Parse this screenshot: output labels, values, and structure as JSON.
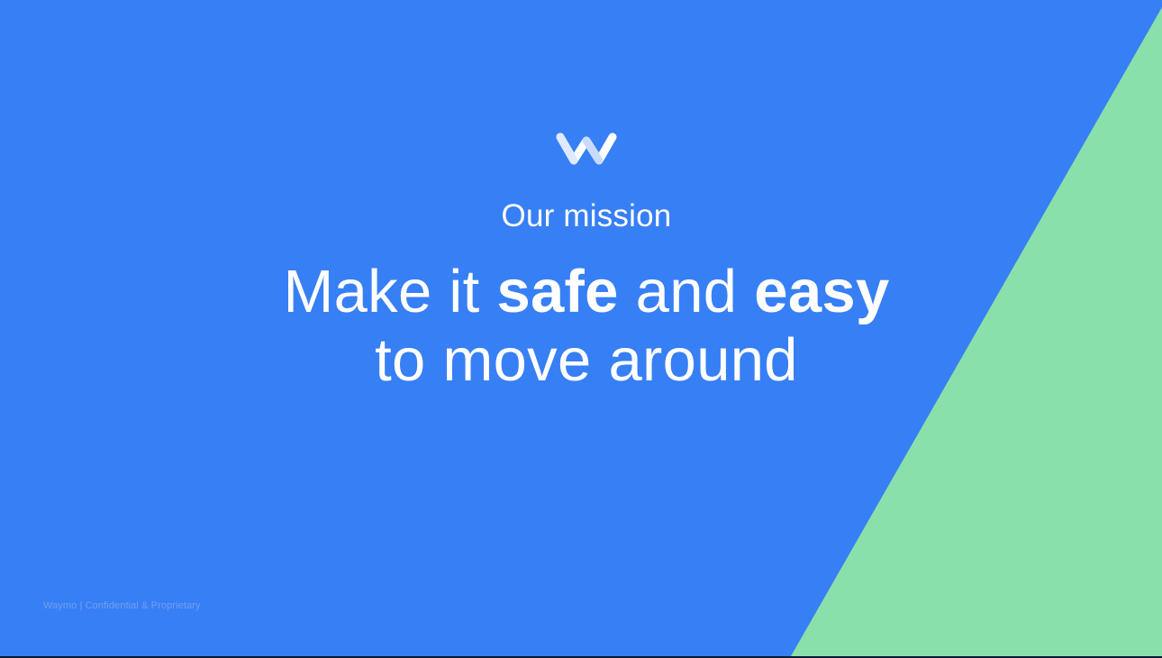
{
  "slide": {
    "kicker": "Our mission",
    "headline": {
      "line1_part1": "Make it ",
      "line1_bold1": "safe",
      "line1_part2": " and ",
      "line1_bold2": "easy",
      "line2": "to move around"
    },
    "footer": "Waymo | Confidential & Proprietary"
  },
  "logo": {
    "icon": "waymo-w-logo-icon"
  },
  "colors": {
    "background_blue": "#377ff5",
    "accent_green": "#8ae0aa",
    "text": "#ffffff",
    "footer_text": "#6fa0f2"
  }
}
